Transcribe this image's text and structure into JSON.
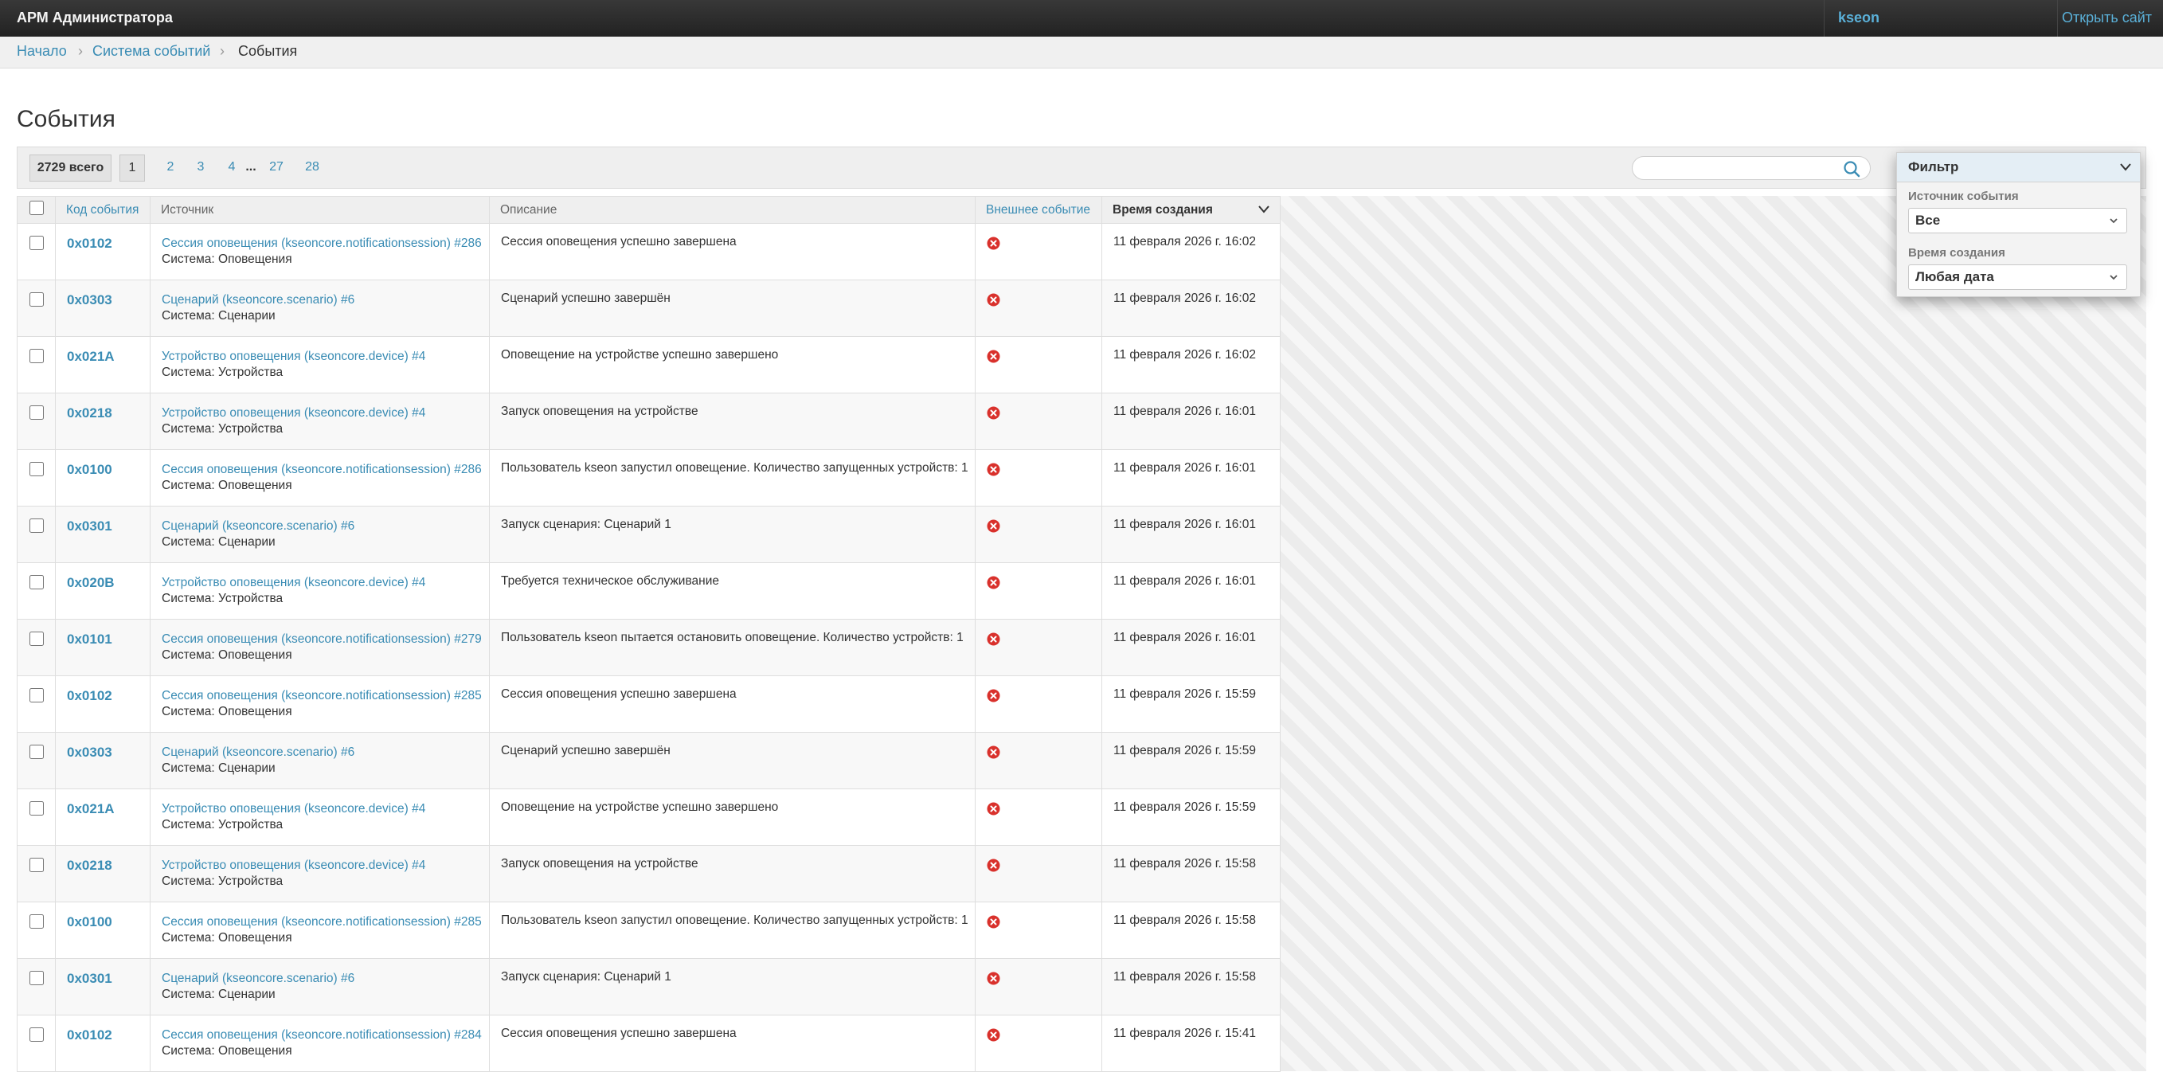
{
  "header": {
    "brand": "АРМ Администратора",
    "user": "kseon",
    "open_site": "Открыть сайт"
  },
  "breadcrumbs": {
    "home": "Начало",
    "section": "Система событий",
    "current": "События"
  },
  "page_title": "События",
  "pagination": {
    "total": "2729 всего",
    "current": "1",
    "pages": [
      "2",
      "3",
      "4"
    ],
    "ellipsis": "...",
    "last_pages": [
      "27",
      "28"
    ]
  },
  "search": {
    "value": "",
    "placeholder": ""
  },
  "table": {
    "columns": {
      "code": "Код события",
      "source": "Источник",
      "description": "Описание",
      "external": "Внешнее событие",
      "created": "Время создания"
    },
    "rows": [
      {
        "code": "0x0102",
        "source_link": "Сессия оповещения (kseoncore.notificationsession) #286",
        "source_system": "Система: Оповещения",
        "description": "Сессия оповещения успешно завершена",
        "time": "11 февраля 2026 г. 16:02"
      },
      {
        "code": "0x0303",
        "source_link": "Сценарий (kseoncore.scenario) #6",
        "source_system": "Система: Сценарии",
        "description": "Сценарий успешно завершён",
        "time": "11 февраля 2026 г. 16:02"
      },
      {
        "code": "0x021A",
        "source_link": "Устройство оповещения (kseoncore.device) #4",
        "source_system": "Система: Устройства",
        "description": "Оповещение на устройстве успешно завершено",
        "time": "11 февраля 2026 г. 16:02"
      },
      {
        "code": "0x0218",
        "source_link": "Устройство оповещения (kseoncore.device) #4",
        "source_system": "Система: Устройства",
        "description": "Запуск оповещения на устройстве",
        "time": "11 февраля 2026 г. 16:01"
      },
      {
        "code": "0x0100",
        "source_link": "Сессия оповещения (kseoncore.notificationsession) #286",
        "source_system": "Система: Оповещения",
        "description": "Пользователь kseon запустил оповещение. Количество запущенных устройств: 1",
        "time": "11 февраля 2026 г. 16:01"
      },
      {
        "code": "0x0301",
        "source_link": "Сценарий (kseoncore.scenario) #6",
        "source_system": "Система: Сценарии",
        "description": "Запуск сценария: Сценарий 1",
        "time": "11 февраля 2026 г. 16:01"
      },
      {
        "code": "0x020B",
        "source_link": "Устройство оповещения (kseoncore.device) #4",
        "source_system": "Система: Устройства",
        "description": "Требуется техническое обслуживание",
        "time": "11 февраля 2026 г. 16:01"
      },
      {
        "code": "0x0101",
        "source_link": "Сессия оповещения (kseoncore.notificationsession) #279",
        "source_system": "Система: Оповещения",
        "description": "Пользователь kseon пытается остановить оповещение. Количество устройств: 1",
        "time": "11 февраля 2026 г. 16:01"
      },
      {
        "code": "0x0102",
        "source_link": "Сессия оповещения (kseoncore.notificationsession) #285",
        "source_system": "Система: Оповещения",
        "description": "Сессия оповещения успешно завершена",
        "time": "11 февраля 2026 г. 15:59"
      },
      {
        "code": "0x0303",
        "source_link": "Сценарий (kseoncore.scenario) #6",
        "source_system": "Система: Сценарии",
        "description": "Сценарий успешно завершён",
        "time": "11 февраля 2026 г. 15:59"
      },
      {
        "code": "0x021A",
        "source_link": "Устройство оповещения (kseoncore.device) #4",
        "source_system": "Система: Устройства",
        "description": "Оповещение на устройстве успешно завершено",
        "time": "11 февраля 2026 г. 15:59"
      },
      {
        "code": "0x0218",
        "source_link": "Устройство оповещения (kseoncore.device) #4",
        "source_system": "Система: Устройства",
        "description": "Запуск оповещения на устройстве",
        "time": "11 февраля 2026 г. 15:58"
      },
      {
        "code": "0x0100",
        "source_link": "Сессия оповещения (kseoncore.notificationsession) #285",
        "source_system": "Система: Оповещения",
        "description": "Пользователь kseon запустил оповещение. Количество запущенных устройств: 1",
        "time": "11 февраля 2026 г. 15:58"
      },
      {
        "code": "0x0301",
        "source_link": "Сценарий (kseoncore.scenario) #6",
        "source_system": "Система: Сценарии",
        "description": "Запуск сценария: Сценарий 1",
        "time": "11 февраля 2026 г. 15:58"
      },
      {
        "code": "0x0102",
        "source_link": "Сессия оповещения (kseoncore.notificationsession) #284",
        "source_system": "Система: Оповещения",
        "description": "Сессия оповещения успешно завершена",
        "time": "11 февраля 2026 г. 15:41"
      }
    ]
  },
  "filter": {
    "title": "Фильтр",
    "source_label": "Источник события",
    "source_value": "Все",
    "time_label": "Время создания",
    "time_value": "Любая дата"
  },
  "icons": {
    "external_false": "red-x-icon",
    "search": "search-icon",
    "sort": "chevron-down-icon"
  },
  "colors": {
    "link": "#3a8cb4",
    "header_bg": "#2b2b2b",
    "error_red": "#d9312c"
  }
}
